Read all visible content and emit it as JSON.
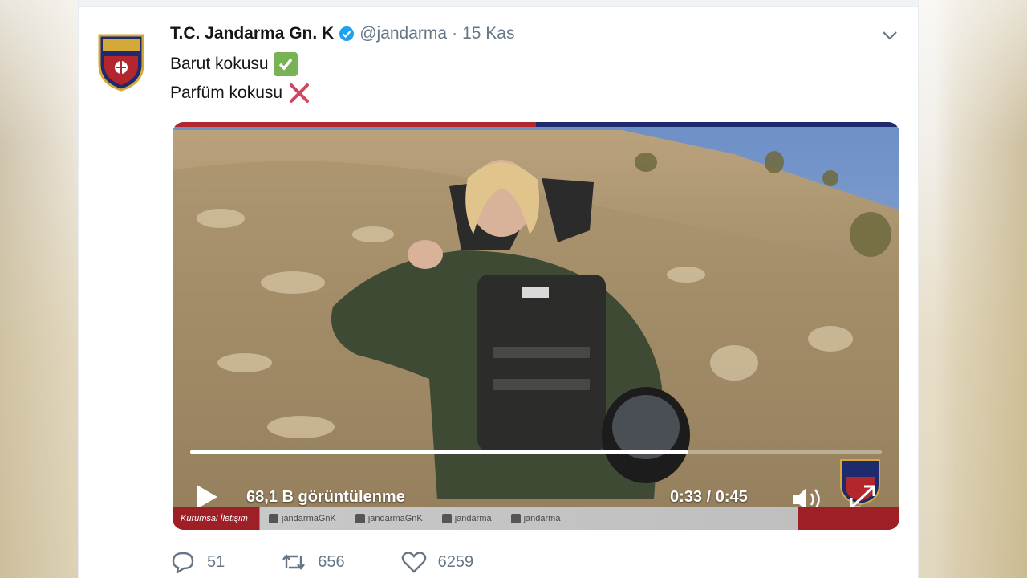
{
  "tweet": {
    "author_name": "T.C. Jandarma Gn. K",
    "handle": "@jandarma",
    "separator": "·",
    "date": "15 Kas",
    "lines": [
      {
        "text": "Barut kokusu",
        "emoji": "white-check-mark"
      },
      {
        "text": "Parfüm kokusu",
        "emoji": "cross-mark"
      }
    ]
  },
  "video": {
    "views": "68,1 B görüntülenme",
    "time": "0:33 / 0:45",
    "progress": 0.72,
    "footer": {
      "corp": "Kurumsal İletişim",
      "socials": [
        "jandarmaGnK",
        "jandarmaGnK",
        "jandarma",
        "jandarma"
      ]
    }
  },
  "actions": {
    "replies": "51",
    "retweets": "656",
    "likes": "6259"
  },
  "colors": {
    "verified": "#1da1f2",
    "text": "#14171a",
    "muted": "#657786",
    "brand_red": "#b3262e",
    "brand_blue": "#1e2a6e"
  }
}
